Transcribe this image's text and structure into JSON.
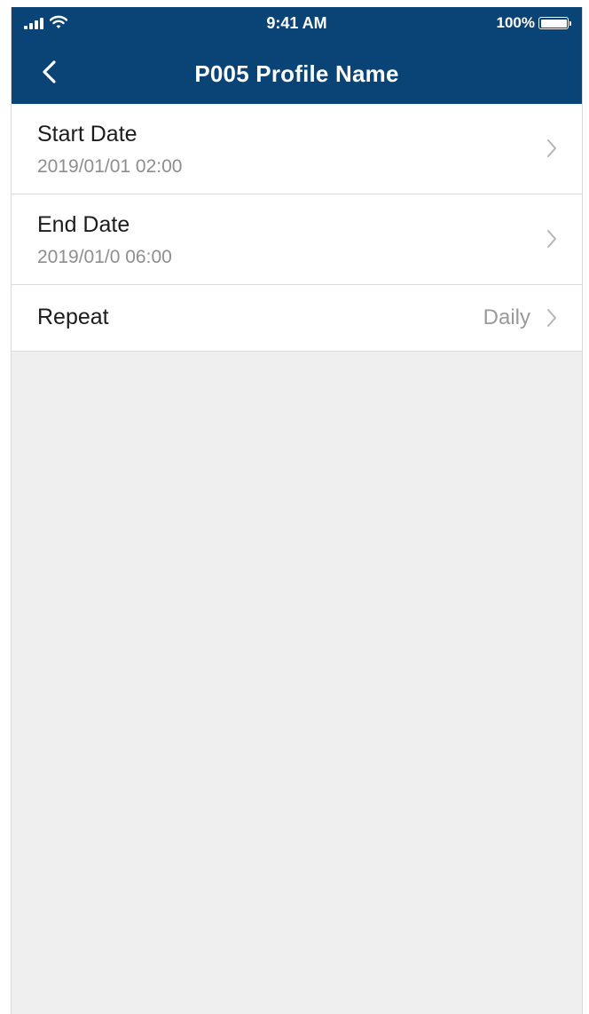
{
  "status_bar": {
    "time": "9:41 AM",
    "battery_percent": "100%",
    "battery_level": 1.0
  },
  "nav": {
    "title": "P005 Profile Name",
    "back_icon": "chevron-left-icon"
  },
  "rows": [
    {
      "label": "Start Date",
      "value": "2019/01/01 02:00"
    },
    {
      "label": "End Date",
      "value": "2019/01/0 06:00"
    },
    {
      "label": "Repeat",
      "value": "Daily"
    }
  ],
  "colors": {
    "header_bg": "#0a4375",
    "page_bg": "#efefef",
    "secondary_text": "#8e8e8e"
  }
}
